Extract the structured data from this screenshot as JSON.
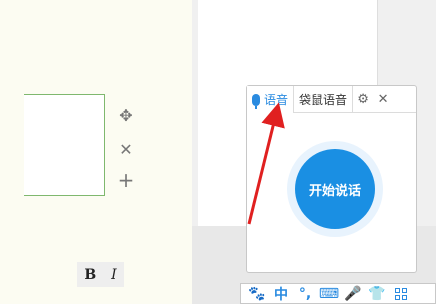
{
  "editor": {
    "bold_label": "B",
    "italic_label": "I"
  },
  "tools": {
    "move_icon": "✥",
    "close_icon": "✕",
    "add_icon": "+"
  },
  "voice_panel": {
    "tabs": [
      {
        "label": "语音",
        "active": true
      },
      {
        "label": "袋鼠语音",
        "active": false
      }
    ],
    "settings_icon": "⚙",
    "close_icon": "✕",
    "start_label": "开始说话",
    "accent_color": "#1a8fe3"
  },
  "status_bar": {
    "items": [
      {
        "icon": "paw-icon",
        "glyph": "🐾"
      },
      {
        "icon": "chinese-mode-icon",
        "glyph": "中"
      },
      {
        "icon": "punctuation-icon",
        "glyph": "°,"
      },
      {
        "icon": "soft-keyboard-icon",
        "glyph": "⌨"
      },
      {
        "icon": "microphone-icon",
        "glyph": "🎤"
      },
      {
        "icon": "skin-icon",
        "glyph": "👕"
      },
      {
        "icon": "toolbox-icon",
        "glyph": "▦"
      }
    ]
  },
  "annotation": {
    "arrow_color": "#e02020"
  }
}
